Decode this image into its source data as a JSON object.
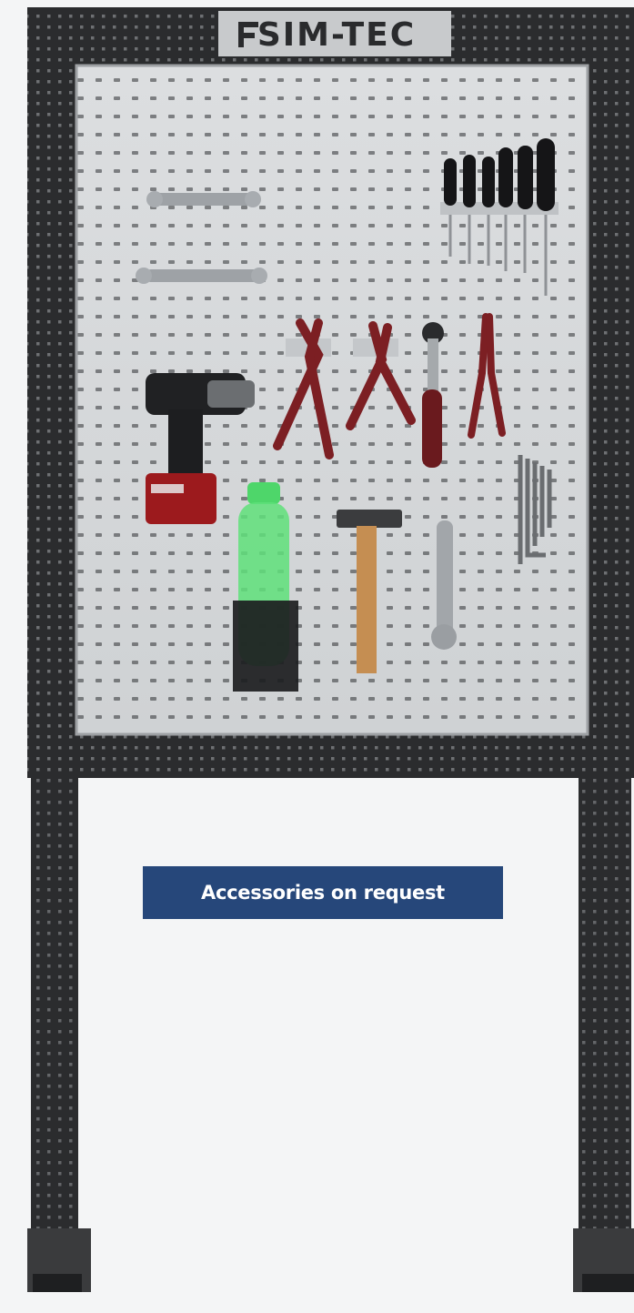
{
  "logo": {
    "text": "SIM-TEC"
  },
  "caption": {
    "text": "Accessories on request"
  },
  "colors": {
    "frame": "#2b2c2e",
    "board": "#d9dbdd",
    "caption_bg": "#26477a",
    "caption_text": "#ffffff",
    "background": "#f4f5f6"
  },
  "items": [
    "combination-wrench",
    "screwdriver-set",
    "cordless-drill",
    "pliers",
    "ratchet",
    "needle-nose-pliers",
    "hex-key-set",
    "water-bottle-holder",
    "hammer",
    "adjustable-wrench"
  ]
}
